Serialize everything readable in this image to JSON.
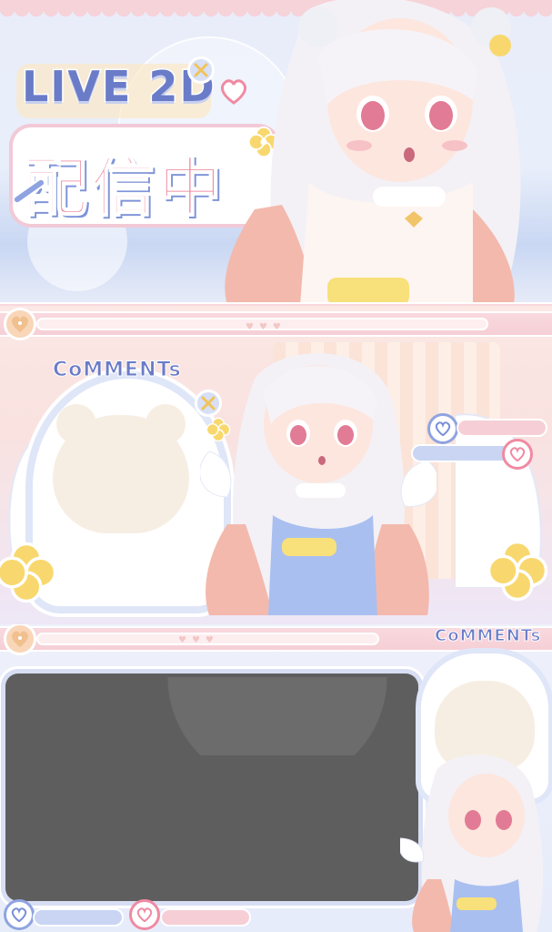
{
  "title_panel": {
    "live_label": "LIVE 2D",
    "streaming_label": "配信中"
  },
  "comments_panel": {
    "title": "CoMMENTs"
  },
  "bottom_panel": {
    "comments_title": "CoMMENTs"
  },
  "icons": {
    "heart_badge": "heart-keyhole-icon",
    "heart_bubble": "heart-icon",
    "flower": "clover-flower-icon",
    "bear": "bear-silhouette-icon",
    "cross": "cross-badge-icon"
  },
  "colors": {
    "pink": "#f6cfd6",
    "blue": "#6a7cc8",
    "peach": "#f9d6b8",
    "yellow": "#f8e07a",
    "lavender": "#dfe6f8"
  }
}
